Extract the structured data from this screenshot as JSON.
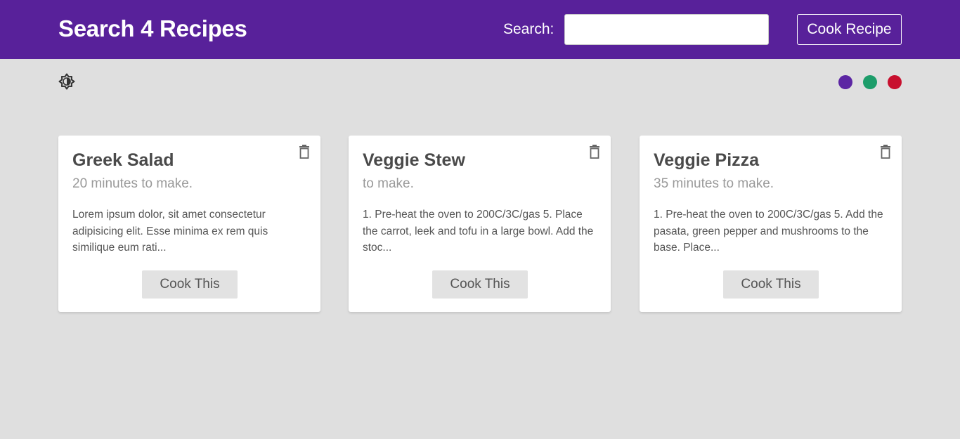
{
  "navbar": {
    "brand": "Search 4 Recipes",
    "search_label": "Search:",
    "search_value": "",
    "search_placeholder": "",
    "cook_recipe_label": "Cook Recipe",
    "background_color": "#58219a"
  },
  "toolbar": {
    "theme_toggle_icon": "brightness-icon",
    "theme_colors": [
      {
        "name": "purple",
        "color": "#5c26a3"
      },
      {
        "name": "green",
        "color": "#1d9d6a"
      },
      {
        "name": "red",
        "color": "#c8102e"
      }
    ]
  },
  "recipes": [
    {
      "title": "Greek Salad",
      "time": "20 minutes to make.",
      "description": "Lorem ipsum dolor, sit amet consectetur adipisicing elit. Esse minima ex rem quis similique eum rati...",
      "button_label": "Cook This",
      "delete_icon": "trash-icon"
    },
    {
      "title": "Veggie Stew",
      "time": "to make.",
      "description": "1. Pre-heat the oven to 200C/3C/gas 5. Place the carrot, leek and tofu in a large bowl. Add the stoc...",
      "button_label": "Cook This",
      "delete_icon": "trash-icon"
    },
    {
      "title": "Veggie Pizza",
      "time": "35 minutes to make.",
      "description": "1. Pre-heat the oven to 200C/3C/gas 5. Add the pasata, green pepper and mushrooms to the base. Place...",
      "button_label": "Cook This",
      "delete_icon": "trash-icon"
    }
  ]
}
